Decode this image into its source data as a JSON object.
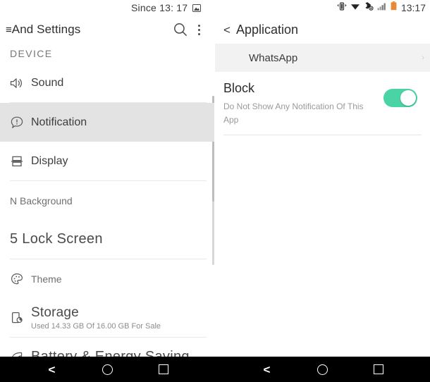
{
  "status_bar": {
    "notification_text": "Since 13: 17",
    "screenshot_icon": "image-icon",
    "vibrate_icon": "vibrate-icon",
    "wifi_icon": "wifi-icon",
    "bluetooth_icon": "bluetooth-data-icon",
    "signal_icon": "signal-bars-icon",
    "battery_icon": "battery-icon",
    "battery_color": "#e8893a",
    "clock": "13:17"
  },
  "left_pane": {
    "toolbar": {
      "menu_icon": "hamburger-icon",
      "title": "And Settings",
      "search_icon": "search-icon",
      "overflow_icon": "more-vertical-icon"
    },
    "section_header": "DEVICE",
    "items": [
      {
        "id": "sound",
        "icon": "speaker-icon",
        "label": "Sound",
        "sub": "",
        "selected": false
      },
      {
        "id": "notification",
        "icon": "notification-icon",
        "label": "Notification",
        "sub": "",
        "selected": true
      },
      {
        "id": "display",
        "icon": "display-icon",
        "label": "Display",
        "sub": "",
        "selected": false
      },
      {
        "id": "background",
        "icon": "",
        "label": "N Background",
        "sub": "",
        "selected": false
      },
      {
        "id": "lockscreen",
        "icon": "",
        "label": "5 Lock Screen",
        "sub": "",
        "selected": false
      },
      {
        "id": "theme",
        "icon": "palette-icon",
        "label": "Theme",
        "sub": "",
        "selected": false
      },
      {
        "id": "storage",
        "icon": "storage-icon",
        "label": "Storage",
        "sub": "Used 14.33 GB Of 16.00 GB For Sale",
        "selected": false
      },
      {
        "id": "battery",
        "icon": "leaf-icon",
        "label": "Battery & Energy Saving",
        "sub": "",
        "selected": false
      }
    ]
  },
  "right_pane": {
    "toolbar": {
      "back_icon": "back-chevron-icon",
      "title": "Application"
    },
    "app_band": {
      "app_name": "WhatsApp",
      "caret_icon": "chevron-right-icon"
    },
    "preference": {
      "title": "Block",
      "subtitle": "Do Not Show Any Notification Of This App",
      "toggle_state": "on",
      "toggle_color": "#4ad3a5"
    }
  },
  "nav_bar": {
    "back_icon": "nav-back-icon",
    "home_icon": "nav-home-icon",
    "recents_icon": "nav-recents-icon"
  }
}
